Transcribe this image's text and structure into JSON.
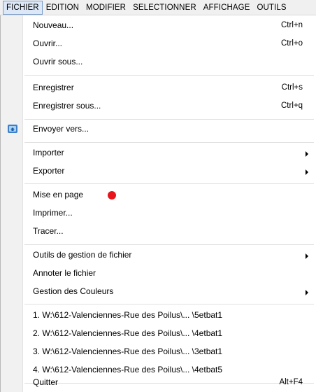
{
  "menubar": {
    "items": [
      {
        "label": "FICHIER"
      },
      {
        "label": "EDITION"
      },
      {
        "label": "MODIFIER"
      },
      {
        "label": "SELECTIONNER"
      },
      {
        "label": "AFFICHAGE"
      },
      {
        "label": "OUTILS"
      }
    ]
  },
  "menu": {
    "nouveau": {
      "label": "Nouveau...",
      "shortcut": "Ctrl+n"
    },
    "ouvrir": {
      "label": "Ouvrir...",
      "shortcut": "Ctrl+o"
    },
    "ouvrir_sous": {
      "label": "Ouvrir sous..."
    },
    "enregistrer": {
      "label": "Enregistrer",
      "shortcut": "Ctrl+s"
    },
    "enregistrer_sous": {
      "label": "Enregistrer sous...",
      "shortcut": "Ctrl+q"
    },
    "envoyer_vers": {
      "label": "Envoyer vers...",
      "icon": "send-icon"
    },
    "importer": {
      "label": "Importer"
    },
    "exporter": {
      "label": "Exporter"
    },
    "mise_en_page": {
      "label": "Mise en page",
      "marker_color": "#e8141b"
    },
    "imprimer": {
      "label": "Imprimer..."
    },
    "tracer": {
      "label": "Tracer..."
    },
    "outils_gestion": {
      "label": "Outils de gestion de fichier"
    },
    "annoter": {
      "label": "Annoter le fichier"
    },
    "gestion_couleurs": {
      "label": "Gestion des Couleurs"
    },
    "recent": [
      {
        "label": "1. W:\\612-Valenciennes-Rue des Poilus\\... \\5etbat1"
      },
      {
        "label": "2. W:\\612-Valenciennes-Rue des Poilus\\... \\4etbat1"
      },
      {
        "label": "3. W:\\612-Valenciennes-Rue des Poilus\\... \\3etbat1"
      },
      {
        "label": "4. W:\\612-Valenciennes-Rue des Poilus\\... \\4etbat5"
      }
    ],
    "quitter": {
      "label": "Quitter",
      "shortcut": "Alt+F4"
    }
  },
  "colors": {
    "active_menu_bg": "#dce8f7",
    "active_menu_border": "#7a9cc8",
    "icon_gutter": "#f1f1f1"
  }
}
